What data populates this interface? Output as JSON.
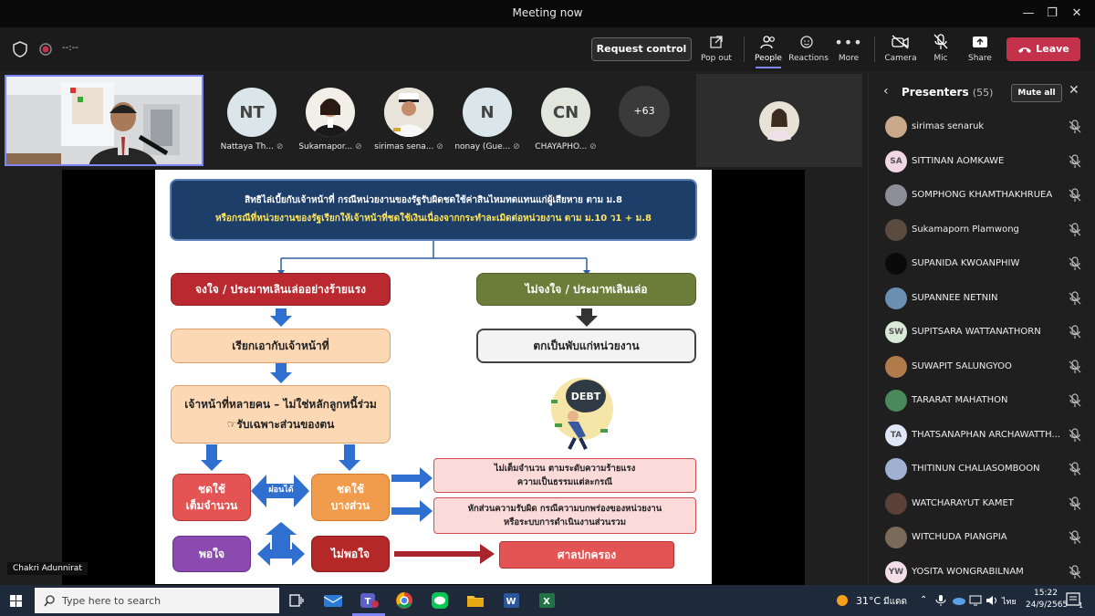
{
  "window": {
    "title": "Meeting now"
  },
  "toolbar": {
    "timer": "--:--",
    "request_control": "Request control",
    "pop_out": "Pop out",
    "people": "People",
    "reactions": "Reactions",
    "more": "More",
    "camera": "Camera",
    "mic": "Mic",
    "share": "Share",
    "leave": "Leave"
  },
  "participants": {
    "tiles": [
      {
        "initials": "NT",
        "name": "Nattaya Th..."
      },
      {
        "initials": "",
        "name": "Sukamapor..."
      },
      {
        "initials": "",
        "name": "sirimas sena..."
      },
      {
        "initials": "N",
        "name": "nonay (Gue..."
      },
      {
        "initials": "CN",
        "name": "CHAYAPHO..."
      }
    ],
    "more_count": "+63"
  },
  "share": {
    "presenter_name": "Chakri Adunnirat",
    "slide": {
      "header_line1": "สิทธิไล่เบี้ยกับเจ้าหน้าที่ กรณีหน่วยงานของรัฐรับผิดชดใช้ค่าสินไหมทดแทนแก่ผู้เสียหาย ตาม ม.8",
      "header_line2": "หรือกรณีที่หน่วยงานของรัฐเรียกให้เจ้าหน้าที่ชดใช้เงินเนื่องจากกระทำละเมิดต่อหน่วยงาน ตาม ม.10 ว1 + ม.8",
      "left_top": "จงใจ / ประมาทเลินเล่ออย่างร้ายแรง",
      "right_top": "ไม่จงใจ / ประมาทเลินเล่อ",
      "left_second": "เรียกเอากับเจ้าหน้าที่",
      "right_second": "ตกเป็นพับแก่หน่วยงาน",
      "multi_line1": "เจ้าหน้าที่หลายคน – ไม่ใช่หลักลูกหนี้ร่วม",
      "multi_line2": "☞รับเฉพาะส่วนของตน",
      "full_pay": "ชดใช้\nเต็มจำนวน",
      "m13": "ม.13",
      "installment": "ผ่อนได้",
      "partial_pay": "ชดใช้\nบางส่วน",
      "not_full_l1": "ไม่เต็มจำนวน ตามระดับความร้ายแรง",
      "not_full_l2": "ความเป็นธรรมแต่ละกรณี",
      "deduct_l1": "หักส่วนความรับผิด กรณีความบกพร่องของหน่วยงาน",
      "deduct_l2": "หรือระบบการดำเนินงานส่วนรวม",
      "satisfied": "พอใจ",
      "unsatisfied": "ไม่พอใจ",
      "court": "ศาลปกครอง",
      "debt_label": "DEBT"
    }
  },
  "panel": {
    "title": "Presenters",
    "count": "(55)",
    "mute_all": "Mute all",
    "people": [
      {
        "initials": "",
        "name": "sirimas senaruk",
        "color": "#c9a98a"
      },
      {
        "initials": "SA",
        "name": "SITTINAN AOMKAWE",
        "color": "#f3d6e4"
      },
      {
        "initials": "",
        "name": "SOMPHONG KHAMTHAKHRUEA",
        "color": "#8d8d9a"
      },
      {
        "initials": "",
        "name": "Sukamaporn Plamwong",
        "color": "#5a4a40"
      },
      {
        "initials": "",
        "name": "SUPANIDA KWOANPHIW",
        "color": "#0a0a0a"
      },
      {
        "initials": "",
        "name": "SUPANNEE NETNIN",
        "color": "#6a8fb0"
      },
      {
        "initials": "SW",
        "name": "SUPITSARA WATTANATHORN",
        "color": "#d9ead8"
      },
      {
        "initials": "",
        "name": "SUWAPIT SALUNGYOO",
        "color": "#b07a4a"
      },
      {
        "initials": "",
        "name": "TARARAT MAHATHON",
        "color": "#4a8a5a"
      },
      {
        "initials": "TA",
        "name": "THATSANAPHAN ARCHAWATTH...",
        "color": "#dfe6f5"
      },
      {
        "initials": "",
        "name": "THITINUN CHALIASOMBOON",
        "color": "#a0b0d0"
      },
      {
        "initials": "",
        "name": "WATCHARAYUT KAMET",
        "color": "#5a4038"
      },
      {
        "initials": "",
        "name": "WITCHUDA PIANGPIA",
        "color": "#7a6a5a"
      },
      {
        "initials": "YW",
        "name": "YOSITA WONGRABILNAM",
        "color": "#f3dde6"
      }
    ]
  },
  "taskbar": {
    "search_placeholder": "Type here to search",
    "temperature": "31°C",
    "weather_desc": "มีแดด",
    "lang": "ไทย",
    "time": "15:22",
    "date": "24/9/2565",
    "notif_count": "1"
  },
  "colors": {
    "accent": "#7f85f5",
    "leave": "#c4314b"
  }
}
